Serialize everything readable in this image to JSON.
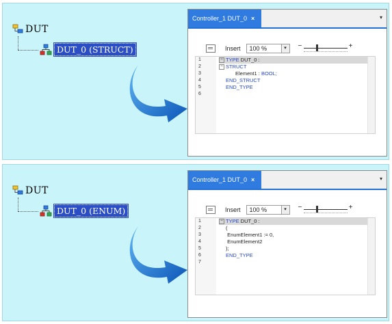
{
  "panels": [
    {
      "tree": {
        "root_label": "DUT",
        "child_label": "DUT_0 (STRUCT)"
      },
      "window": {
        "tab_title": "Controller_1 DUT_0",
        "close_glyph": "×",
        "dropdown_glyph": "▾",
        "toolbar": {
          "mode_label": "Insert",
          "zoom_value": "100 %",
          "zoom_dropdown_glyph": "▾",
          "slider_minus": "−",
          "slider_plus": "+"
        },
        "line_numbers": [
          "1",
          "2",
          "3",
          "4",
          "5",
          "6"
        ],
        "code_lines": [
          {
            "kw": "TYPE",
            "text": " DUT_0 :"
          },
          {
            "kw": "STRUCT",
            "text": ""
          },
          {
            "kw": "",
            "text": "Element1 : ",
            "type": "BOOL;"
          },
          {
            "kw": "END_STRUCT",
            "text": ""
          },
          {
            "kw": "END_TYPE",
            "text": ""
          },
          {
            "kw": "",
            "text": ""
          }
        ]
      }
    },
    {
      "tree": {
        "root_label": "DUT",
        "child_label": "DUT_0 (ENUM)"
      },
      "window": {
        "tab_title": "Controller_1 DUT_0",
        "close_glyph": "×",
        "dropdown_glyph": "▾",
        "toolbar": {
          "mode_label": "Insert",
          "zoom_value": "100 %",
          "zoom_dropdown_glyph": "▾",
          "slider_minus": "−",
          "slider_plus": "+"
        },
        "line_numbers": [
          "1",
          "2",
          "3",
          "4",
          "5",
          "6",
          "7"
        ],
        "code_lines": [
          {
            "kw": "TYPE",
            "text": " DUT_0 :"
          },
          {
            "kw": "",
            "text": "("
          },
          {
            "kw": "",
            "text": "  EnumElement1 := 0,"
          },
          {
            "kw": "",
            "text": "  EnumElement2"
          },
          {
            "kw": "",
            "text": ");"
          },
          {
            "kw": "END_TYPE",
            "text": ""
          },
          {
            "kw": "",
            "text": ""
          }
        ]
      }
    }
  ],
  "colors": {
    "panel_bg": "#c9f4f9",
    "tab_blue": "#2f7be0",
    "selection_blue": "#2b4ec4",
    "arrow_blue": "#1e6fd0",
    "keyword_blue": "#2548c8"
  }
}
